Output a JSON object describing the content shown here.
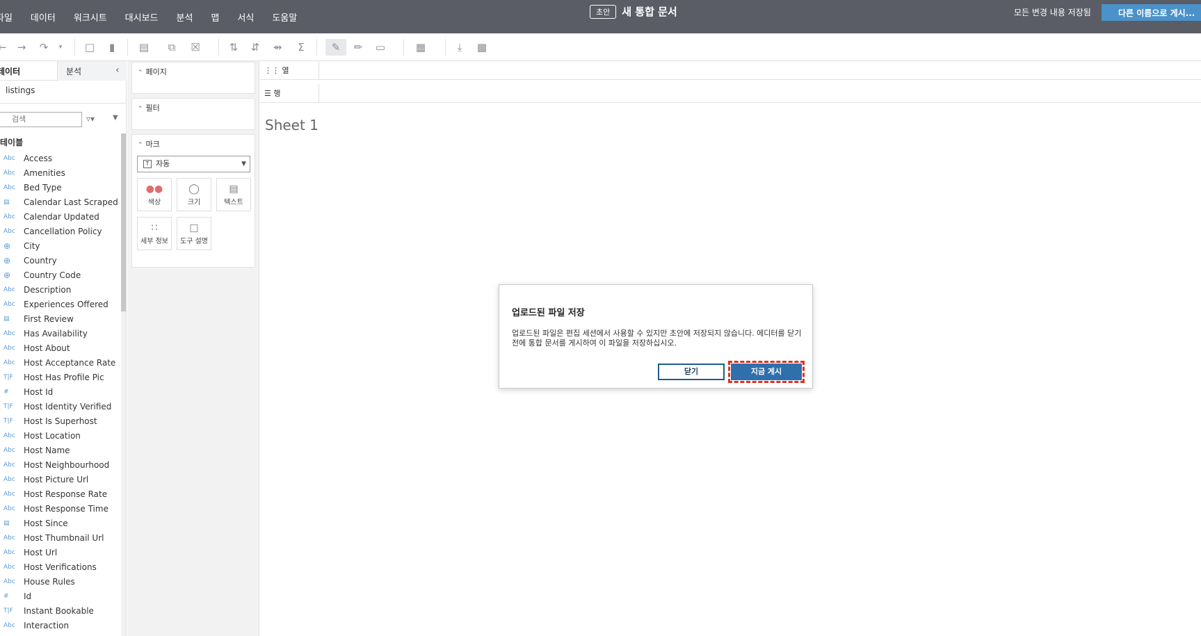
{
  "menubar": {
    "items": [
      "파일",
      "데이터",
      "워크시트",
      "대시보드",
      "분석",
      "맵",
      "서식",
      "도움말"
    ],
    "draft_badge": "초안",
    "document_title": "새 통합 문서",
    "save_status": "모든 변경 내용 저장됨",
    "publish_as_label": "다른 이름으로 게시..."
  },
  "datapane": {
    "tab_data": "데이터",
    "tab_analysis": "분석",
    "datasource": "listings",
    "search_placeholder": "검색",
    "tables_header": "테이블",
    "fields": [
      {
        "type": "Abc",
        "name": "Access"
      },
      {
        "type": "Abc",
        "name": "Amenities"
      },
      {
        "type": "Abc",
        "name": "Bed Type"
      },
      {
        "type": "date",
        "name": "Calendar Last Scraped"
      },
      {
        "type": "Abc",
        "name": "Calendar Updated"
      },
      {
        "type": "Abc",
        "name": "Cancellation Policy"
      },
      {
        "type": "geo",
        "name": "City"
      },
      {
        "type": "geo",
        "name": "Country"
      },
      {
        "type": "geo",
        "name": "Country Code"
      },
      {
        "type": "Abc",
        "name": "Description"
      },
      {
        "type": "Abc",
        "name": "Experiences Offered"
      },
      {
        "type": "date",
        "name": "First Review"
      },
      {
        "type": "Abc",
        "name": "Has Availability"
      },
      {
        "type": "Abc",
        "name": "Host About"
      },
      {
        "type": "Abc",
        "name": "Host Acceptance Rate"
      },
      {
        "type": "T|F",
        "name": "Host Has Profile Pic"
      },
      {
        "type": "#",
        "name": "Host Id"
      },
      {
        "type": "T|F",
        "name": "Host Identity Verified"
      },
      {
        "type": "T|F",
        "name": "Host Is Superhost"
      },
      {
        "type": "Abc",
        "name": "Host Location"
      },
      {
        "type": "Abc",
        "name": "Host Name"
      },
      {
        "type": "Abc",
        "name": "Host Neighbourhood"
      },
      {
        "type": "Abc",
        "name": "Host Picture Url"
      },
      {
        "type": "Abc",
        "name": "Host Response Rate"
      },
      {
        "type": "Abc",
        "name": "Host Response Time"
      },
      {
        "type": "date",
        "name": "Host Since"
      },
      {
        "type": "Abc",
        "name": "Host Thumbnail Url"
      },
      {
        "type": "Abc",
        "name": "Host Url"
      },
      {
        "type": "Abc",
        "name": "Host Verifications"
      },
      {
        "type": "Abc",
        "name": "House Rules"
      },
      {
        "type": "#",
        "name": "Id"
      },
      {
        "type": "T|F",
        "name": "Instant Bookable"
      },
      {
        "type": "Abc",
        "name": "Interaction"
      }
    ]
  },
  "cards": {
    "pages_title": "페이지",
    "filters_title": "필터",
    "marks_title": "마크",
    "marks_type": "자동",
    "mark_color": "색상",
    "mark_size": "크기",
    "mark_text": "텍스트",
    "mark_detail": "세부 정보",
    "mark_tooltip": "도구 설명"
  },
  "shelves": {
    "columns_label": "열",
    "rows_label": "행"
  },
  "canvas": {
    "sheet_title": "Sheet 1"
  },
  "dialog": {
    "title": "업로드된 파일 저장",
    "body": "업로드된 파일은 편집 세션에서 사용할 수 있지만 초안에 저장되지 않습니다. 에디터를 닫기 전에 통합 문서를 게시하여 이 파일을 저장하십시오.",
    "close_label": "닫기",
    "publish_label": "지금 게시"
  },
  "colors": {
    "topbar": "#5a5d66",
    "publish_as": "#4a92c9",
    "dialog_primary": "#2f6fab",
    "highlight": "#e0301e"
  }
}
